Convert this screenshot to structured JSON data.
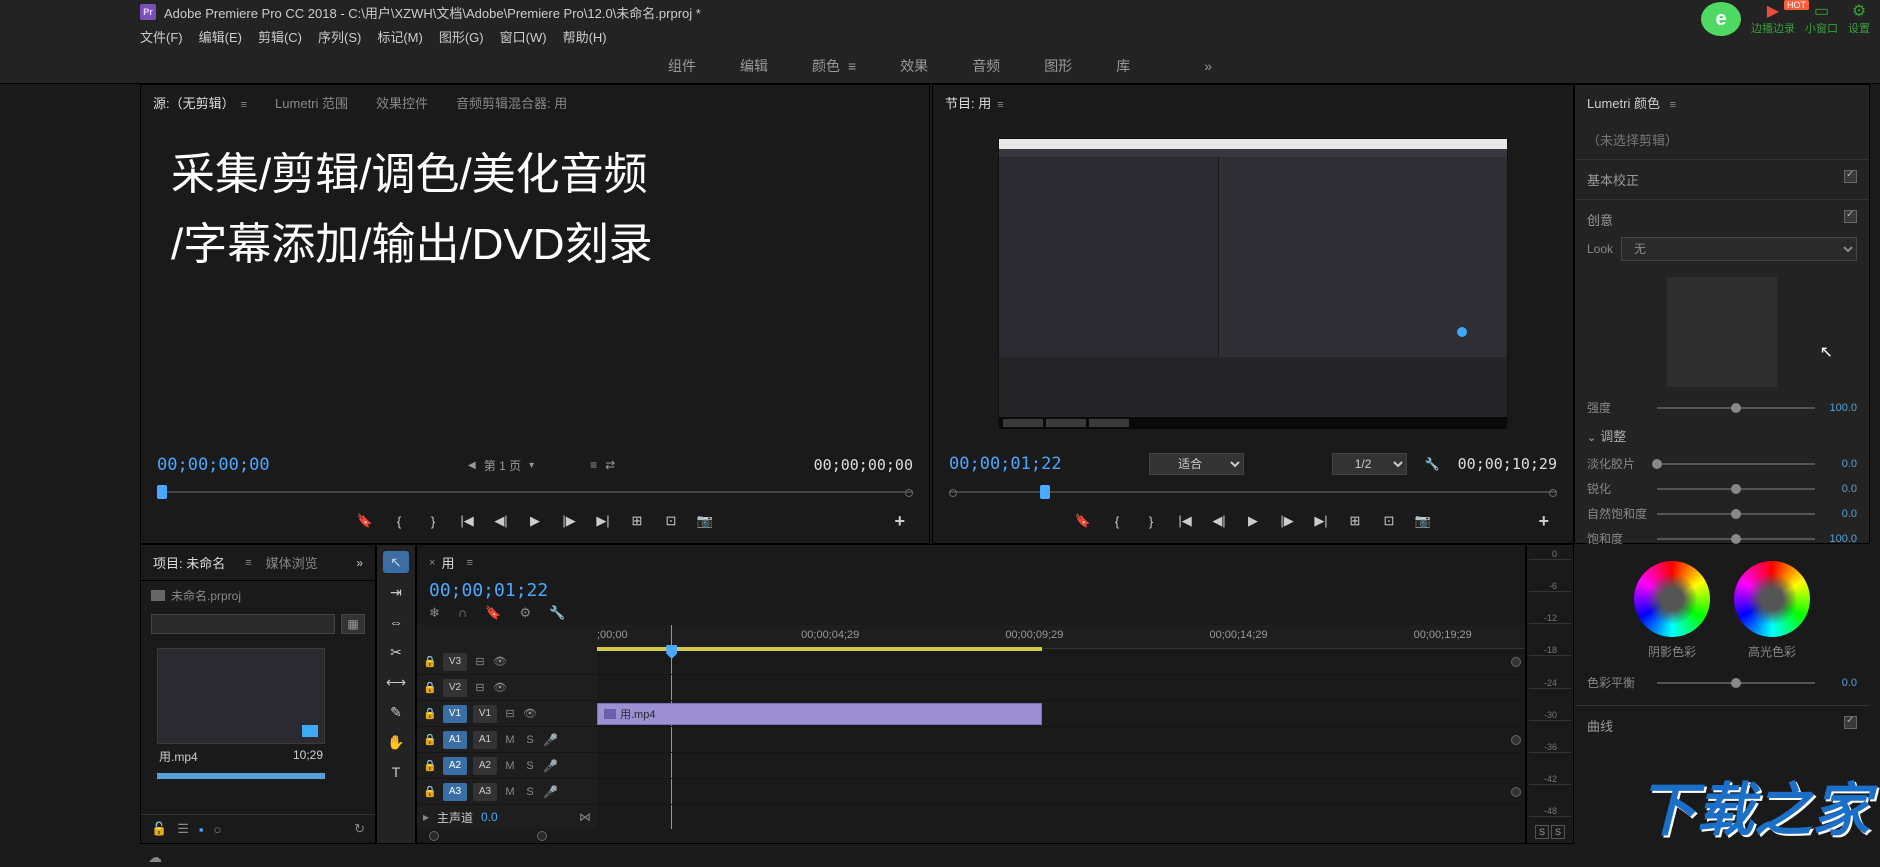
{
  "titlebar": {
    "app_name": "Adobe Premiere Pro CC 2018",
    "path": "C:\\用户\\XZWH\\文档\\Adobe\\Premiere Pro\\12.0\\未命名.prproj *",
    "icon_text": "Pr"
  },
  "browser_tools": {
    "record": "边播边录",
    "hot": "HOT",
    "miniwin": "小窗口",
    "settings": "设置"
  },
  "menu": {
    "file": "文件(F)",
    "edit": "编辑(E)",
    "clip": "剪辑(C)",
    "sequence": "序列(S)",
    "markers": "标记(M)",
    "graphics": "图形(G)",
    "window": "窗口(W)",
    "help": "帮助(H)"
  },
  "workspaces": {
    "assembly": "组件",
    "editing": "编辑",
    "color": "颜色",
    "effects": "效果",
    "audio": "音频",
    "graphics": "图形",
    "libraries": "库"
  },
  "source": {
    "tab_source": "源:（无剪辑）",
    "tab_lumetri_scope": "Lumetri 范围",
    "tab_effect_controls": "效果控件",
    "tab_audio_mixer": "音频剪辑混合器: 用",
    "demo_line1": "采集/剪辑/调色/美化音频",
    "demo_line2": "/字幕添加/输出/DVD刻录",
    "tc_left": "00;00;00;00",
    "tc_right": "00;00;00;00",
    "page": "第 1 页"
  },
  "program": {
    "tab": "节目: 用",
    "tc_left": "00;00;01;22",
    "fit": "适合",
    "zoom": "1/2",
    "tc_right": "00;00;10;29"
  },
  "lumetri": {
    "title": "Lumetri 颜色",
    "no_selection": "（未选择剪辑）",
    "basic": "基本校正",
    "creative": "创意",
    "look_label": "Look",
    "look_value": "无",
    "intensity": "强度",
    "intensity_val": "100.0",
    "adjust": "调整",
    "faded": "淡化胶片",
    "faded_val": "0.0",
    "sharpen": "锐化",
    "sharpen_val": "0.0",
    "vibrance": "自然饱和度",
    "vibrance_val": "0.0",
    "saturation": "饱和度",
    "saturation_val": "100.0",
    "shadow_tint": "阴影色彩",
    "highlight_tint": "高光色彩",
    "balance": "色彩平衡",
    "balance_val": "0.0",
    "curves": "曲线"
  },
  "project": {
    "tab_project": "项目: 未命名",
    "tab_media": "媒体浏览",
    "filename": "未命名.prproj",
    "clip_name": "用.mp4",
    "clip_dur": "10;29"
  },
  "timeline": {
    "tab": "用",
    "tc": "00;00;01;22",
    "ruler": [
      ";00;00",
      "00;00;04;29",
      "00;00;09;29",
      "00;00;14;29",
      "00;00;19;29"
    ],
    "tracks": {
      "v3": "V3",
      "v2": "V2",
      "v1": "V1",
      "a1": "A1",
      "a2": "A2",
      "a3": "A3"
    },
    "clip_name": "用.mp4",
    "ms": "M",
    "solo": "S",
    "master": "主声道",
    "master_val": "0.0"
  },
  "meter": {
    "marks": [
      "0",
      "-6",
      "-12",
      "-18",
      "-24",
      "-30",
      "-36",
      "-42",
      "-48"
    ],
    "s": "S"
  },
  "watermark": "下载之家"
}
